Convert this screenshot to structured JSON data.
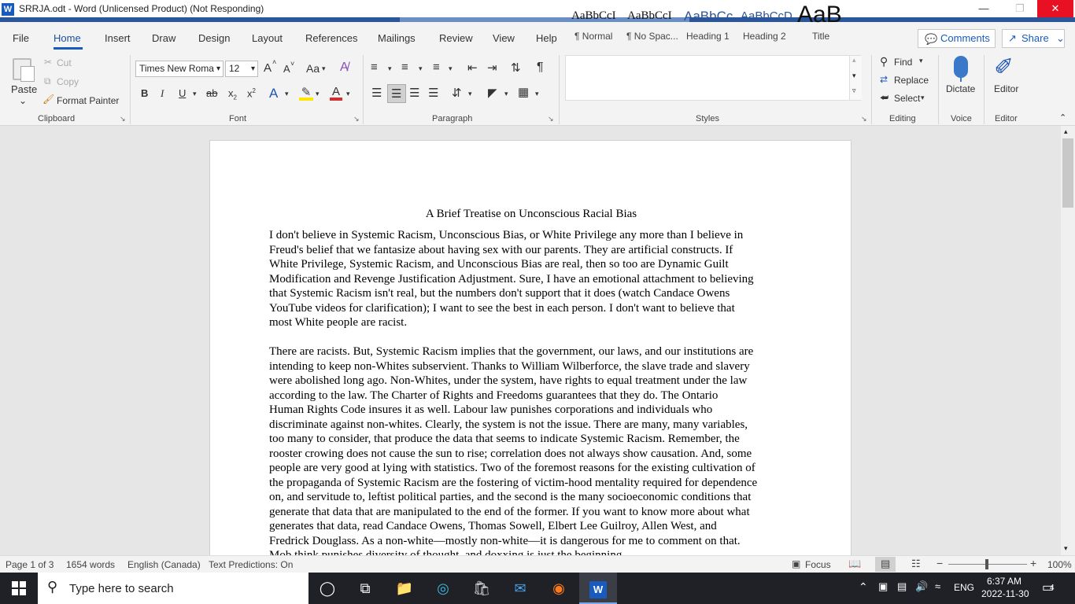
{
  "window": {
    "title": "SRRJA.odt - Word (Unlicensed Product) (Not Responding)",
    "app_icon": "W",
    "controls": {
      "minimize": "—",
      "restore": "❐",
      "close": "✕"
    }
  },
  "tabs": [
    "File",
    "Home",
    "Insert",
    "Draw",
    "Design",
    "Layout",
    "References",
    "Mailings",
    "Review",
    "View",
    "Help"
  ],
  "active_tab": "Home",
  "header_buttons": {
    "comments": "Comments",
    "share": "Share"
  },
  "ribbon": {
    "clipboard": {
      "paste": "Paste",
      "cut": "Cut",
      "copy": "Copy",
      "format_painter": "Format Painter",
      "label": "Clipboard"
    },
    "font": {
      "family": "Times New Roma",
      "size": "12",
      "label": "Font",
      "grow": "A",
      "shrink": "A",
      "case": "Aa",
      "bold": "B",
      "italic": "I",
      "underline": "U",
      "strike": "ab",
      "subscript": "x",
      "superscript": "x",
      "text_effects": "A",
      "font_color": "A"
    },
    "paragraph": {
      "label": "Paragraph"
    },
    "styles": {
      "label": "Styles",
      "items": [
        {
          "preview": "AaBbCcI",
          "name": "¶ Normal"
        },
        {
          "preview": "AaBbCcI",
          "name": "¶ No Spac..."
        },
        {
          "preview": "AaBbCc",
          "name": "Heading 1"
        },
        {
          "preview": "AaBbCcD",
          "name": "Heading 2"
        },
        {
          "preview": "AaB",
          "name": "Title"
        }
      ]
    },
    "editing": {
      "find": "Find",
      "replace": "Replace",
      "select": "Select",
      "label": "Editing"
    },
    "voice": {
      "dictate": "Dictate",
      "label": "Voice"
    },
    "editor": {
      "editor": "Editor",
      "label": "Editor"
    }
  },
  "document": {
    "title": "A Brief Treatise on Unconscious Racial Bias",
    "paragraphs": [
      [
        "I don't believe in Systemic Racism, Unconscious Bias, or White Privilege any more than I believe in",
        "Freud's belief that we fantasize about having sex with our parents.  They are artificial constructs.  If",
        "White Privilege, Systemic Racism, and Unconscious Bias are real, then so too are Dynamic Guilt",
        "Modification and Revenge Justification Adjustment.  Sure, I have an emotional attachment to believing",
        "that Systemic Racism isn't real, but the numbers don't support that it does (watch Candace Owens",
        "YouTube videos for clarification); I want to see the best in each person.  I don't want to believe that",
        "most White people are racist."
      ],
      [
        "There are racists.  But, Systemic Racism implies that the government, our laws, and our institutions are",
        "intending to keep non-Whites subservient.  Thanks to William Wilberforce, the slave trade and slavery",
        "were abolished long ago.  Non-Whites, under the system, have rights to equal treatment under the law",
        "according to the law.  The Charter of Rights and Freedoms guarantees that they do.  The Ontario",
        "Human Rights Code insures it as well.  Labour law punishes corporations and individuals who",
        "discriminate against non-whites.  Clearly, the system is not the issue.  There are many, many variables,",
        "too many to consider, that produce the data that seems to indicate Systemic Racism.  Remember, the",
        "rooster crowing does not cause the sun to rise; correlation does not always show causation.  And, some",
        "people are very good at lying with statistics.  Two of the foremost reasons for the existing cultivation of",
        "the propaganda of Systemic Racism are the fostering of victim-hood mentality required for dependence",
        "on, and servitude to, leftist political parties, and the second is the many socioeconomic conditions that",
        "generate that data that are manipulated to the end of the former.  If you want to know more about what",
        "generates that data, read Candace Owens, Thomas Sowell, Elbert Lee Guilroy, Allen West, and",
        "Fredrick Douglass.  As a non-white—mostly non-white—it is dangerous for me to comment on that.",
        "Mob think punishes diversity of thought, and doxxing is just the beginning."
      ]
    ]
  },
  "status": {
    "page": "Page 1 of 3",
    "words": "1654 words",
    "language": "English (Canada)",
    "predictions": "Text Predictions: On",
    "focus": "Focus",
    "zoom": "100%"
  },
  "taskbar": {
    "search_placeholder": "Type here to search",
    "time": "6:37 AM",
    "date": "2022-11-30",
    "lang": "ENG",
    "notifications": "4"
  }
}
